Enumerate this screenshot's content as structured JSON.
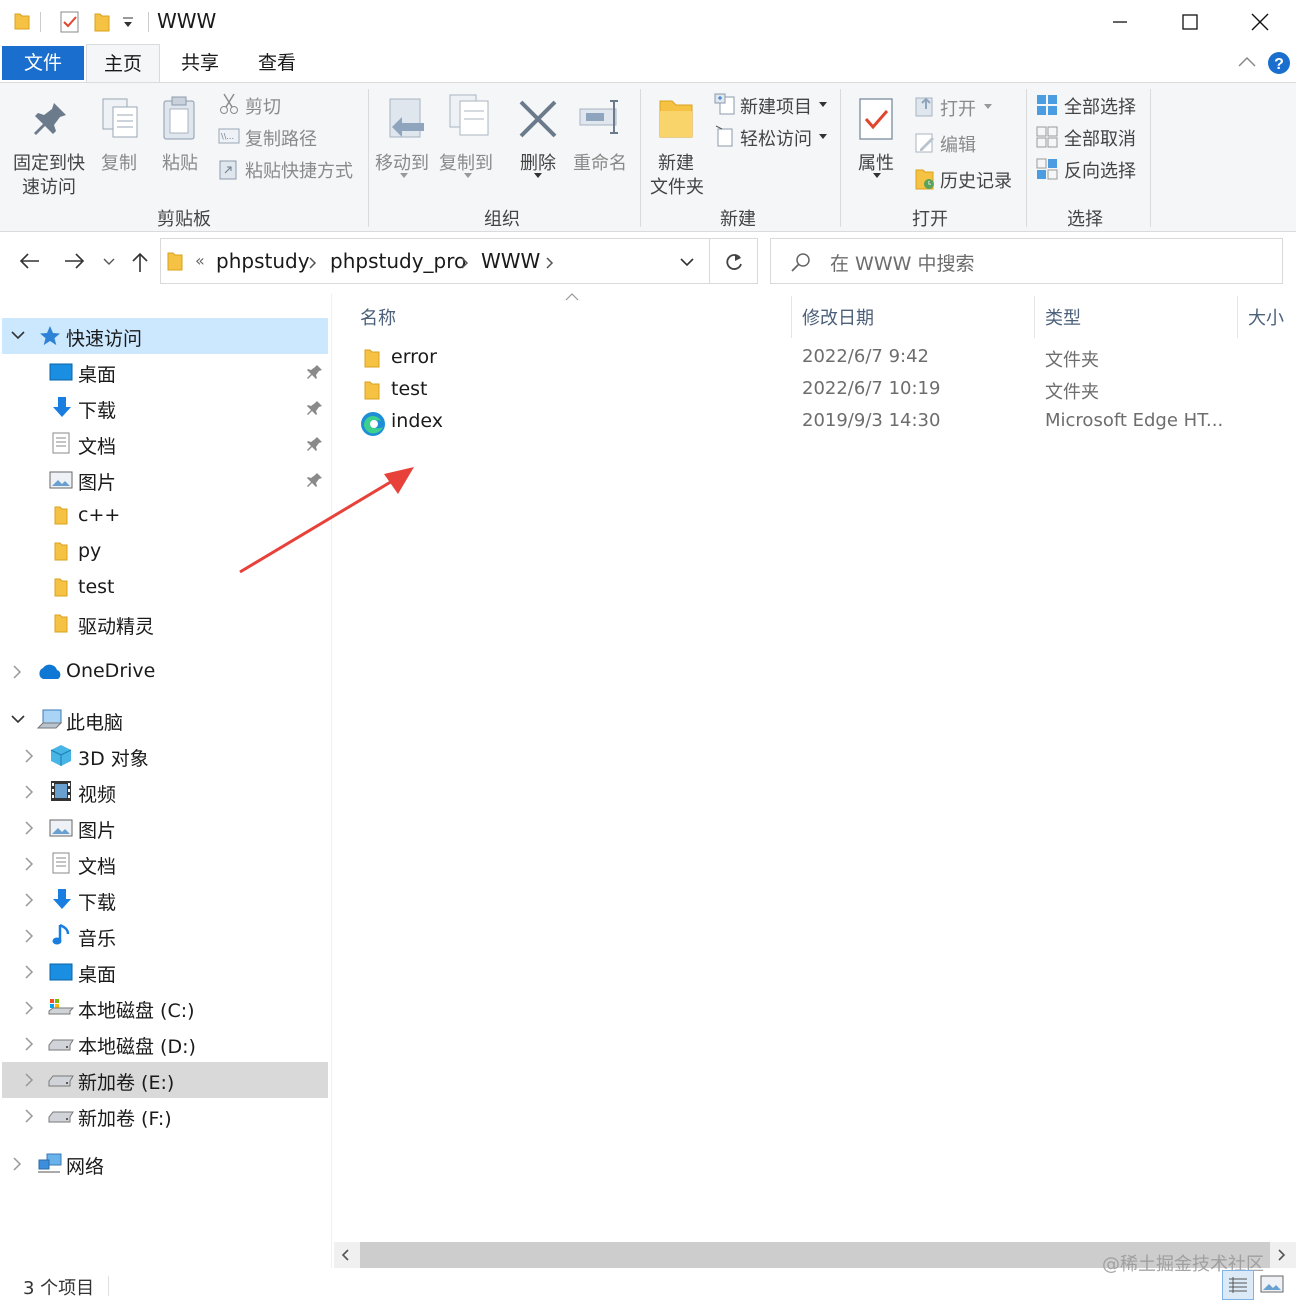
{
  "window": {
    "title": "WWW",
    "qat_icons": [
      "folder-icon",
      "properties-check-icon",
      "new-folder-icon",
      "customize-dropdown-icon"
    ]
  },
  "ribbon_tabs": {
    "file": "文件",
    "home": "主页",
    "share": "共享",
    "view": "查看"
  },
  "ribbon": {
    "clipboard": {
      "group": "剪贴板",
      "pin_line1": "固定到快",
      "pin_line2": "速访问",
      "copy": "复制",
      "paste": "粘贴",
      "cut": "剪切",
      "copy_path": "复制路径",
      "paste_shortcut": "粘贴快捷方式"
    },
    "organize": {
      "group": "组织",
      "move_to": "移动到",
      "copy_to": "复制到",
      "delete": "删除",
      "rename": "重命名"
    },
    "new": {
      "group": "新建",
      "new_folder_line1": "新建",
      "new_folder_line2": "文件夹",
      "new_item": "新建项目",
      "easy_access": "轻松访问"
    },
    "open": {
      "group": "打开",
      "properties": "属性",
      "open": "打开",
      "edit": "编辑",
      "history": "历史记录"
    },
    "select": {
      "group": "选择",
      "select_all": "全部选择",
      "select_none": "全部取消",
      "invert": "反向选择"
    }
  },
  "address": {
    "overflow": "«",
    "crumbs": [
      "phpstudy",
      "phpstudy_pro",
      "WWW"
    ],
    "search_placeholder": "在 WWW 中搜索"
  },
  "nav": {
    "quick_access": "快速访问",
    "quick_items": [
      {
        "label": "桌面",
        "pinned": true
      },
      {
        "label": "下载",
        "pinned": true
      },
      {
        "label": "文档",
        "pinned": true
      },
      {
        "label": "图片",
        "pinned": true
      },
      {
        "label": "c++",
        "pinned": false
      },
      {
        "label": "py",
        "pinned": false
      },
      {
        "label": "test",
        "pinned": false
      },
      {
        "label": "驱动精灵",
        "pinned": false
      }
    ],
    "onedrive": "OneDrive",
    "this_pc": "此电脑",
    "pc_items": [
      "3D 对象",
      "视频",
      "图片",
      "文档",
      "下载",
      "音乐",
      "桌面",
      "本地磁盘 (C:)",
      "本地磁盘 (D:)",
      "新加卷 (E:)",
      "新加卷 (F:)"
    ],
    "network": "网络"
  },
  "columns": {
    "name": "名称",
    "date": "修改日期",
    "type": "类型",
    "size": "大小"
  },
  "files": [
    {
      "name": "error",
      "date": "2022/6/7 9:42",
      "type": "文件夹",
      "icon": "folder-icon"
    },
    {
      "name": "test",
      "date": "2022/6/7 10:19",
      "type": "文件夹",
      "icon": "folder-icon"
    },
    {
      "name": "index",
      "date": "2019/9/3 14:30",
      "type": "Microsoft Edge HT...",
      "icon": "edge-icon"
    }
  ],
  "status": {
    "count": "3 个项目",
    "watermark": "@稀土掘金技术社区"
  },
  "colors": {
    "accent": "#1a6fce",
    "selected_bg": "#cce8ff",
    "hover_bg": "#d9d9d9",
    "annotation_arrow": "#e8413a"
  }
}
